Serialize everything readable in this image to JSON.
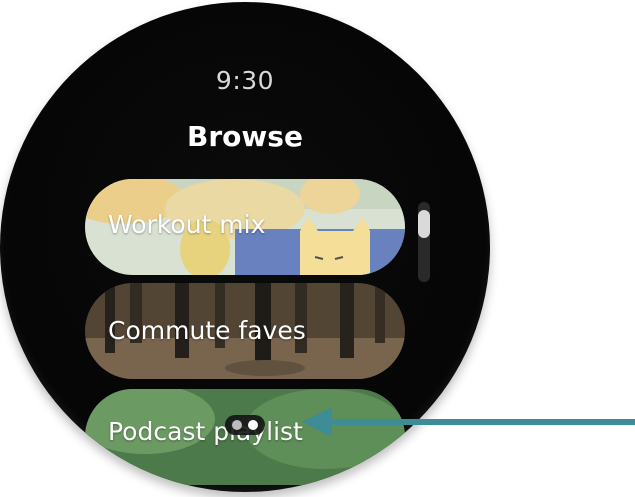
{
  "status": {
    "time": "9:30"
  },
  "screen": {
    "title": "Browse"
  },
  "playlists": [
    {
      "label": "Workout mix"
    },
    {
      "label": "Commute faves"
    },
    {
      "label": "Podcast playlist"
    }
  ],
  "scroll": {
    "position": 0.15
  },
  "page_indicator": {
    "count": 2,
    "active": 2
  },
  "colors": {
    "watch_bg": "#000000",
    "annotation_arrow": "#3d8c96",
    "scroll_thumb": "#d9d9d9"
  }
}
